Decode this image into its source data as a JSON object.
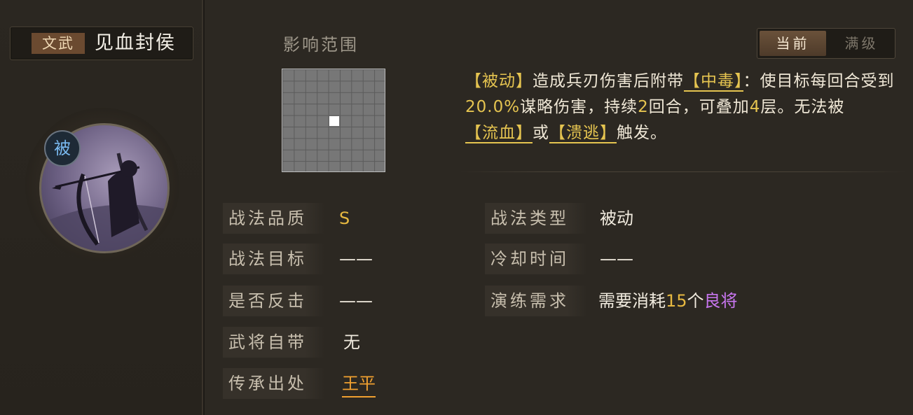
{
  "skill": {
    "category": "文武",
    "name": "见血封侯",
    "passive_badge": "被"
  },
  "range": {
    "label": "影响范围"
  },
  "toggle": {
    "current": "当前",
    "max": "满级"
  },
  "description": {
    "p1": "【被动】",
    "p2": "造成兵刃伤害后附带",
    "p3": "【中毒】",
    "p4": "：使目标每回合受到",
    "p5": "20.0%",
    "p6": "谋略伤害，持续",
    "p7": "2",
    "p8": "回合，可叠加",
    "p9": "4",
    "p10": "层。无法被",
    "p11": "【流血】",
    "p12": "或",
    "p13": "【溃逃】",
    "p14": "触发。"
  },
  "attributes": {
    "quality_label": "战法品质",
    "quality_value": "S",
    "target_label": "战法目标",
    "target_value": "——",
    "counter_label": "是否反击",
    "counter_value": "——",
    "innate_label": "武将自带",
    "innate_value": "无",
    "source_label": "传承出处",
    "source_value": "王平",
    "type_label": "战法类型",
    "type_value": "被动",
    "cooldown_label": "冷却时间",
    "cooldown_value": "——",
    "train_label": "演练需求",
    "train_prefix": "需要消耗",
    "train_count": "15",
    "train_unit": "个",
    "train_item": "良将"
  },
  "colors": {
    "accent_gold": "#e5c450",
    "link_orange": "#f0a030",
    "purple_rank": "#c876f0",
    "passive_blue": "#79b9f0"
  }
}
